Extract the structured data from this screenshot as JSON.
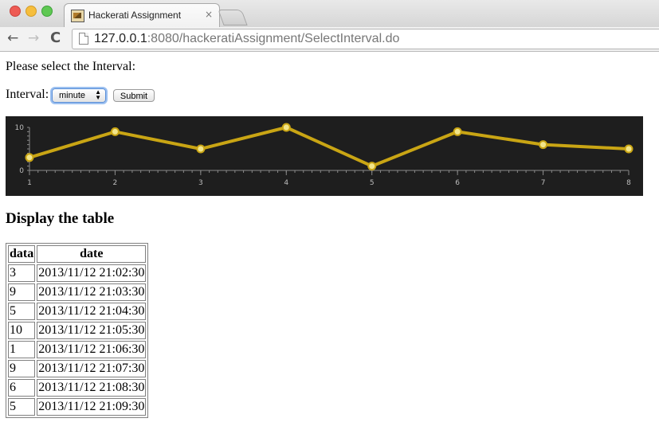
{
  "browser": {
    "tab_title": "Hackerati Assignment",
    "tab_close": "×",
    "url_host": "127.0.0.1",
    "url_rest": ":8080/hackeratiAssignment/SelectInterval.do",
    "back_glyph": "←",
    "forward_glyph": "→",
    "reload_glyph": "C"
  },
  "page": {
    "prompt": "Please select the Interval:",
    "interval_label": "Interval:",
    "select_value": "minute",
    "select_arrows": "▲▼",
    "submit_label": "Submit",
    "section_title": "Display the table"
  },
  "table": {
    "headers": [
      "data",
      "date"
    ],
    "rows": [
      [
        "3",
        "2013/11/12 21:02:30"
      ],
      [
        "9",
        "2013/11/12 21:03:30"
      ],
      [
        "5",
        "2013/11/12 21:04:30"
      ],
      [
        "10",
        "2013/11/12 21:05:30"
      ],
      [
        "1",
        "2013/11/12 21:06:30"
      ],
      [
        "9",
        "2013/11/12 21:07:30"
      ],
      [
        "6",
        "2013/11/12 21:08:30"
      ],
      [
        "5",
        "2013/11/12 21:09:30"
      ]
    ]
  },
  "chart_data": {
    "type": "line",
    "x": [
      1,
      2,
      3,
      4,
      5,
      6,
      7,
      8
    ],
    "series": [
      {
        "values": [
          3,
          9,
          5,
          10,
          1,
          9,
          6,
          5
        ]
      }
    ],
    "xlim": [
      1,
      8
    ],
    "ylim": [
      0,
      10
    ],
    "x_ticks": [
      1,
      2,
      3,
      4,
      5,
      6,
      7,
      8
    ],
    "y_ticks": [
      0,
      10
    ],
    "grid": false,
    "colors": {
      "background": "#1e1e1e",
      "line": "#c9a514",
      "point_fill": "#f2e58a",
      "point_stroke": "#c9a514",
      "axis": "#8a8a8a",
      "tick_text": "#bdbdbd"
    }
  }
}
